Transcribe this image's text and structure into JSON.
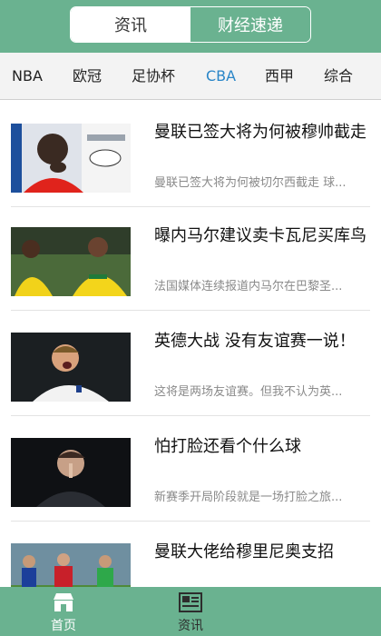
{
  "header": {
    "segments": [
      {
        "label": "资讯",
        "active": true
      },
      {
        "label": "财经速递",
        "active": false
      }
    ]
  },
  "subnav": {
    "items": [
      {
        "label": "NBA",
        "active": false
      },
      {
        "label": "欧冠",
        "active": false
      },
      {
        "label": "足协杯",
        "active": false
      },
      {
        "label": "CBA",
        "active": true
      },
      {
        "label": "西甲",
        "active": false
      },
      {
        "label": "综合",
        "active": false
      }
    ]
  },
  "news": [
    {
      "title": "曼联已签大将为何被穆帅截走",
      "desc": "曼联已签大将为何被切尔西截走 球...",
      "thumb_icon": "football-player-photo-icon"
    },
    {
      "title": "曝内马尔建议卖卡瓦尼买库鸟",
      "desc": "法国媒体连续报道内马尔在巴黎圣...",
      "thumb_icon": "football-players-celebrating-icon"
    },
    {
      "title": "英德大战 没有友谊赛一说！",
      "desc": "这将是两场友谊赛。但我不认为英...",
      "thumb_icon": "england-player-shouting-icon"
    },
    {
      "title": "怕打脸还看个什么球",
      "desc": "新赛季开局阶段就是一场打脸之旅...",
      "thumb_icon": "player-hush-gesture-icon"
    },
    {
      "title": "曼联大佬给穆里尼奥支招",
      "desc": "",
      "thumb_icon": "match-action-photo-icon"
    }
  ],
  "tabbar": {
    "items": [
      {
        "label": "首页",
        "icon": "home-store-icon",
        "active": true
      },
      {
        "label": "资讯",
        "icon": "newspaper-icon",
        "active": false
      }
    ]
  },
  "colors": {
    "brand_green": "#6ab290",
    "active_blue": "#2a86c8"
  }
}
